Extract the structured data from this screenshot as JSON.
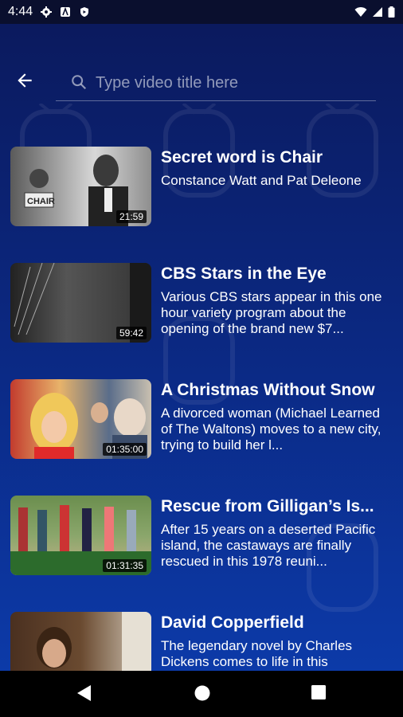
{
  "status_bar": {
    "time": "4:44",
    "left_icons": [
      "gear-icon",
      "a-icon",
      "shield-icon"
    ],
    "right_icons": [
      "wifi-icon",
      "signal-icon",
      "battery-icon"
    ]
  },
  "search": {
    "placeholder": "Type video title here",
    "value": ""
  },
  "videos": [
    {
      "title": "Secret word is Chair",
      "description": "Constance Watt and Pat Deleone",
      "duration": "21:59"
    },
    {
      "title": "CBS Stars in the Eye",
      "description": "Various CBS stars appear in this one hour variety program about the opening of the brand new $7...",
      "duration": "59:42"
    },
    {
      "title": "A Christmas Without Snow",
      "description": "A divorced woman (Michael Learned of The Waltons) moves to a new city, trying to build her l...",
      "duration": "01:35:00"
    },
    {
      "title": "Rescue from Gilligan’s Is...",
      "description": "After 15 years on a deserted Pacific island, the castaways are finally rescued in this 1978 reuni...",
      "duration": "01:31:35"
    },
    {
      "title": "David Copperfield",
      "description": "The legendary novel by Charles Dickens comes to life in this",
      "duration": ""
    }
  ],
  "nav": {
    "icons": [
      "back-triangle-icon",
      "home-circle-icon",
      "recents-square-icon"
    ]
  }
}
